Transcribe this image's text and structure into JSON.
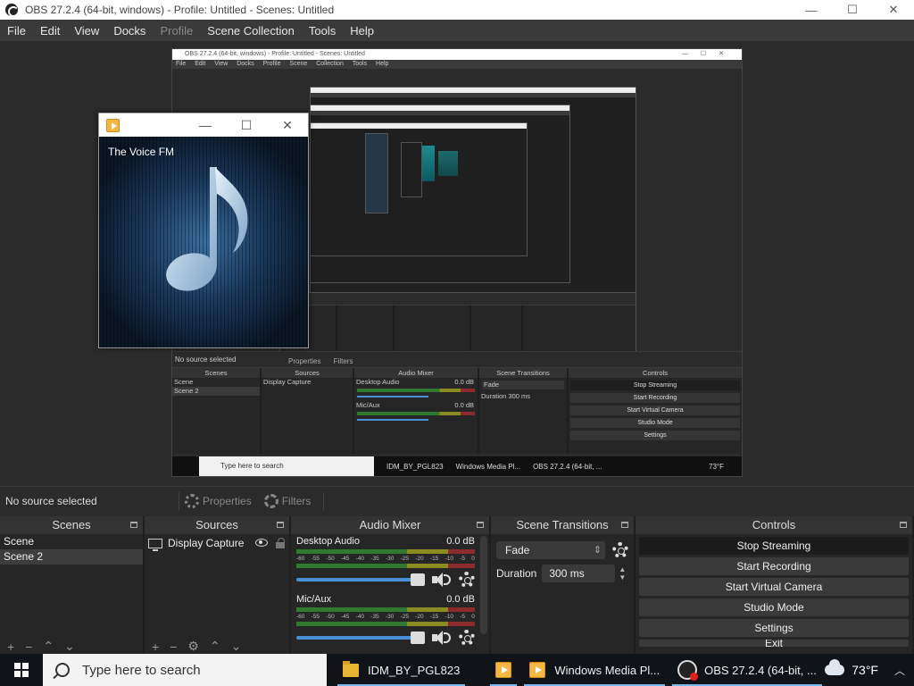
{
  "window": {
    "title": "OBS 27.2.4 (64-bit, windows) - Profile: Untitled - Scenes: Untitled",
    "controls": {
      "minimize": "—",
      "maximize": "☐",
      "close": "✕"
    }
  },
  "menu": [
    {
      "label": "File",
      "enabled": true
    },
    {
      "label": "Edit",
      "enabled": true
    },
    {
      "label": "View",
      "enabled": true
    },
    {
      "label": "Docks",
      "enabled": true
    },
    {
      "label": "Profile",
      "enabled": false
    },
    {
      "label": "Scene Collection",
      "enabled": true
    },
    {
      "label": "Tools",
      "enabled": true
    },
    {
      "label": "Help",
      "enabled": true
    }
  ],
  "preview": {
    "nested_title": "OBS 27.2.4 (64-bit, windows) - Profile: Untitled - Scenes: Untitled",
    "nested_menu": "File Edit View Docks Profile Scene Collection Tools Help",
    "nested_status": "No source selected",
    "nested_toolbar": "Properties Filters",
    "nested_docks": {
      "scenes": {
        "title": "Scenes",
        "items": [
          "Scene",
          "Scene 2"
        ]
      },
      "sources": {
        "title": "Sources",
        "items": [
          "Display Capture"
        ]
      },
      "mixer": {
        "title": "Audio Mixer",
        "ch1": "Desktop Audio",
        "ch2": "Mic/Aux",
        "db": "0.0 dB"
      },
      "transitions": {
        "title": "Scene Transitions",
        "type": "Fade",
        "duration_label": "Duration",
        "duration": "300 ms"
      },
      "controls": {
        "title": "Controls",
        "buttons": [
          "Stop Streaming",
          "Start Recording",
          "Start Virtual Camera",
          "Studio Mode",
          "Settings"
        ]
      }
    },
    "nested_taskbar": {
      "search": "Type here to search",
      "items": [
        "IDM_BY_PGL823",
        "Windows Media Pl...",
        "OBS 27.2.4 (64-bit, ..."
      ],
      "weather": "73°F"
    }
  },
  "media_player": {
    "station": "The Voice FM",
    "controls": {
      "minimize": "—",
      "maximize": "☐",
      "close": "✕"
    }
  },
  "status": {
    "selection": "No source selected",
    "properties_label": "Properties",
    "filters_label": "Filters"
  },
  "scenes_dock": {
    "title": "Scenes",
    "items": [
      {
        "label": "Scene",
        "selected": false
      },
      {
        "label": "Scene 2",
        "selected": true
      }
    ],
    "toolbar": [
      "+",
      "−",
      "⌃",
      "⌄"
    ]
  },
  "sources_dock": {
    "title": "Sources",
    "items": [
      {
        "label": "Display Capture",
        "visible": true,
        "locked": true
      }
    ],
    "toolbar": [
      "+",
      "−",
      "⚙",
      "⌃",
      "⌄"
    ]
  },
  "mixer_dock": {
    "title": "Audio Mixer",
    "scale": [
      "-60",
      "-55",
      "-50",
      "-45",
      "-40",
      "-35",
      "-30",
      "-25",
      "-20",
      "-15",
      "-10",
      "-5",
      "0"
    ],
    "channels": [
      {
        "name": "Desktop Audio",
        "db": "0.0 dB",
        "level": 0.0,
        "volume": 1.0
      },
      {
        "name": "Mic/Aux",
        "db": "0.0 dB",
        "level": 0.0,
        "volume": 1.0
      }
    ]
  },
  "transitions_dock": {
    "title": "Scene Transitions",
    "type": "Fade",
    "duration_label": "Duration",
    "duration": "300 ms"
  },
  "controls_dock": {
    "title": "Controls",
    "buttons": [
      {
        "label": "Stop Streaming",
        "active": true
      },
      {
        "label": "Start Recording",
        "active": false
      },
      {
        "label": "Start Virtual Camera",
        "active": false
      },
      {
        "label": "Studio Mode",
        "active": false
      },
      {
        "label": "Settings",
        "active": false
      },
      {
        "label": "Exit",
        "active": false
      }
    ]
  },
  "taskbar": {
    "search_placeholder": "Type here to search",
    "items": [
      {
        "label": "IDM_BY_PGL823",
        "icon": "folder-icon"
      },
      {
        "label": "",
        "icon": "media-player-icon"
      },
      {
        "label": "Windows Media Pl...",
        "icon": "media-player-icon"
      },
      {
        "label": "OBS 27.2.4 (64-bit, ...",
        "icon": "obs-icon"
      }
    ],
    "weather": "73°F"
  }
}
